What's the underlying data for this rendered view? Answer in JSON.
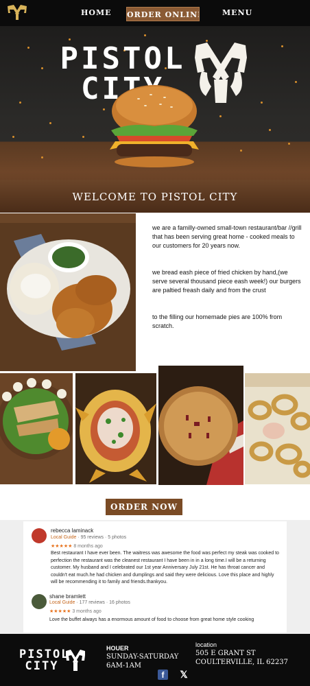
{
  "nav": {
    "home": "HOME",
    "order_online": "ORDER ONLINE",
    "menu": "MENU",
    "logo_icon": "crossed-pistols-icon"
  },
  "hero": {
    "title_line1": "PISTOL",
    "title_line2": "CITY",
    "welcome": "WELCOME TO PISTOL CITY"
  },
  "intro": {
    "paragraphs": [
      "we are a familly-owned small-town restaurant/bar //grill that has been serving great home - cooked meals to our customers for 20 years now.",
      "we bread eash piece of fried chicken by hand,(we serve several  thousand piece eash week!) our burgers are paltied freash daily and from the crust",
      "to the filling our homemade pies are 100% from scratch."
    ]
  },
  "order_button": "ORDER NOW",
  "reviews": [
    {
      "name": "rebecca laminack",
      "guide": "Local Guide",
      "meta": " · 95 reviews · 5 photos",
      "stars": "★★★★★",
      "date": "8 months ago",
      "text": "Best restaurant I have ever been. The waitress was awesome the food was perfect my steak was cooked to perfection the restaurant was the cleanest restaurant I have been in in a long time.I will be a returning customer. My husband and I celebrated our 1st year Anniversary July 21st. He has throat cancer and couldn't eat much.he had chicken and dumplings and said they were delicious. Love this place and highly will be recommending it to family and friends.thankyou.",
      "avatar_color": "#c0392b"
    },
    {
      "name": "shane bramlett",
      "guide": "Local Guide",
      "meta": " · 177 reviews · 16 photos",
      "stars": "★★★★★",
      "date": "3 months ago",
      "text": "Love the buffet always has a enormous amount of food to choose from great home style cooking",
      "avatar_color": "#4a5a3a"
    }
  ],
  "footer": {
    "logo_line1": "PISTOL",
    "logo_line2": "CITY",
    "hours_label": "HOUER",
    "hours_days": "SUNDAY-SATURDAY",
    "hours_time": "6AM-1AM",
    "location_label": "location",
    "address_line1": "505 E GRANT ST",
    "address_line2": "COULTERVILLE, IL 62237",
    "facebook_icon": "facebook-icon",
    "x_icon": "x-icon"
  },
  "colors": {
    "nav_bg": "#0b0b0b",
    "accent_brown": "#8a5a34",
    "star": "#e7711b",
    "guide": "#c5651a"
  }
}
